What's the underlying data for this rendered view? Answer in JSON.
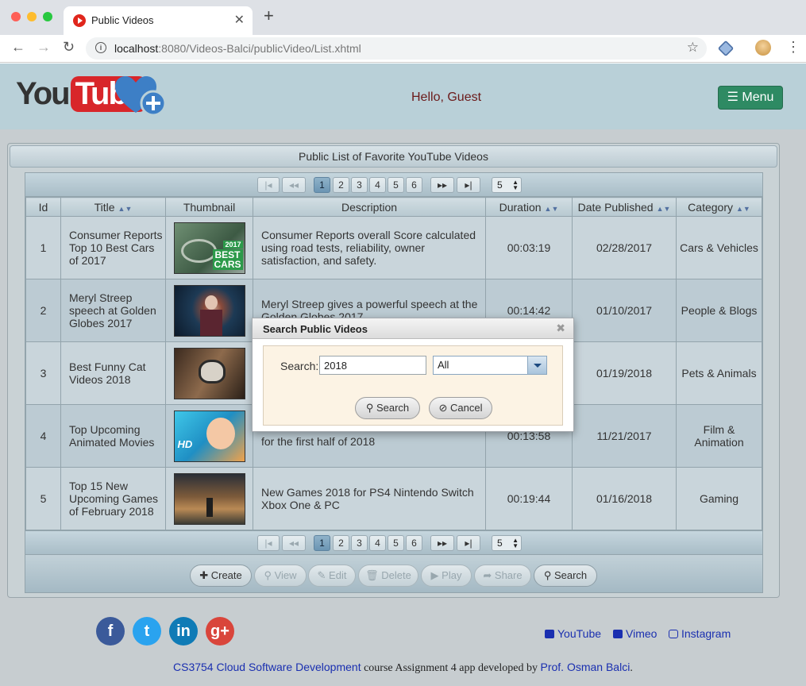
{
  "browser": {
    "tab_title": "Public Videos",
    "url_host": "localhost",
    "url_rest": ":8080/Videos-Balci/publicVideo/List.xhtml"
  },
  "header": {
    "logo_you": "You",
    "logo_tube": "Tube",
    "greeting": "Hello, Guest",
    "menu_label": "☰ Menu"
  },
  "panel": {
    "title": "Public List of Favorite YouTube Videos"
  },
  "pager": {
    "first": "|◂",
    "prev": "◂◂",
    "next": "▸▸",
    "last": "▸|",
    "pages": [
      "1",
      "2",
      "3",
      "4",
      "5",
      "6"
    ],
    "current_page": "1",
    "rows_per_page": "5"
  },
  "table": {
    "headers": [
      "Id",
      "Title",
      "Thumbnail",
      "Description",
      "Duration",
      "Date Published",
      "Category"
    ],
    "rows": [
      {
        "id": "1",
        "title": "Consumer Reports Top 10 Best Cars of 2017",
        "description": "Consumer Reports overall Score calculated using road tests, reliability, owner satisfaction, and safety.",
        "duration": "00:03:19",
        "date": "02/28/2017",
        "category": "Cars & Vehicles",
        "thumb_text": "BEST CARS",
        "thumb_year": "2017"
      },
      {
        "id": "2",
        "title": "Meryl Streep speech at Golden Globes 2017",
        "description": "Meryl Streep gives a powerful speech at the Golden Globes 2017",
        "duration": "00:14:42",
        "date": "01/10/2017",
        "category": "People & Blogs"
      },
      {
        "id": "3",
        "title": "Best Funny Cat Videos 2018",
        "description": "",
        "duration": "",
        "date": "01/19/2018",
        "category": "Pets & Animals"
      },
      {
        "id": "4",
        "title": "Top Upcoming Animated Movies",
        "description": "for the first half of 2018",
        "duration": "00:13:58",
        "date": "11/21/2017",
        "category": "Film & Animation",
        "thumb_text": "HD"
      },
      {
        "id": "5",
        "title": "Top 15 New Upcoming Games of February 2018",
        "description": "New Games 2018 for PS4 Nintendo Switch Xbox One & PC",
        "duration": "00:19:44",
        "date": "01/16/2018",
        "category": "Gaming"
      }
    ]
  },
  "toolbar": {
    "create": "Create",
    "view": "View",
    "edit": "Edit",
    "delete": "Delete",
    "play": "Play",
    "share": "Share",
    "search": "Search"
  },
  "dialog": {
    "title": "Search Public Videos",
    "search_label": "Search:",
    "search_value": "2018",
    "scope_value": "All",
    "search_button": "Search",
    "cancel_button": "Cancel"
  },
  "footer": {
    "social": [
      "f",
      "t",
      "in",
      "g+"
    ],
    "links": [
      "YouTube",
      "Vimeo",
      "Instagram"
    ],
    "credit_link": "CS3754 Cloud Software Development",
    "credit_text": " course Assignment 4 app developed by ",
    "author_link": "Prof. Osman Balci",
    "credit_end": "."
  },
  "colors": {
    "header_bg": "#b9d0d8",
    "menu_btn": "#2e8a63",
    "greeting": "#6b1a1a",
    "link": "#1a2fb0",
    "facebook": "#3b5a9a",
    "twitter": "#2aa3ef",
    "linkedin": "#0f7bb6",
    "googleplus": "#d9453b"
  }
}
